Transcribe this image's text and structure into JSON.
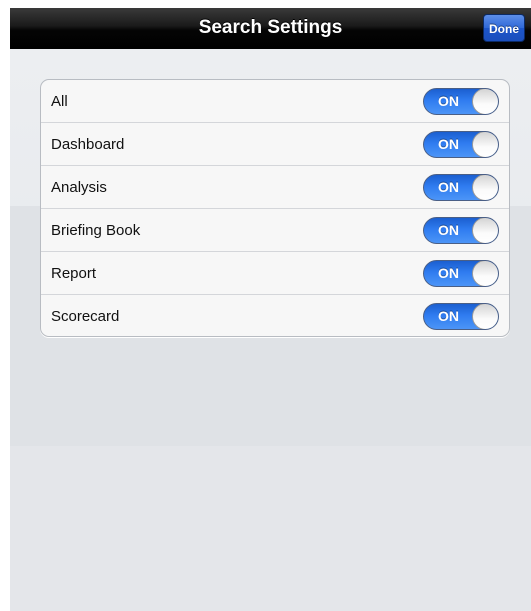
{
  "navbar": {
    "title": "Search Settings",
    "done_label": "Done"
  },
  "settings": {
    "items": [
      {
        "label": "All",
        "state": "ON"
      },
      {
        "label": "Dashboard",
        "state": "ON"
      },
      {
        "label": "Analysis",
        "state": "ON"
      },
      {
        "label": "Briefing Book",
        "state": "ON"
      },
      {
        "label": "Report",
        "state": "ON"
      },
      {
        "label": "Scorecard",
        "state": "ON"
      }
    ]
  },
  "colors": {
    "toggle_on": "#2f7cf0",
    "done_button": "#2f68d8",
    "navbar": "#000000"
  }
}
